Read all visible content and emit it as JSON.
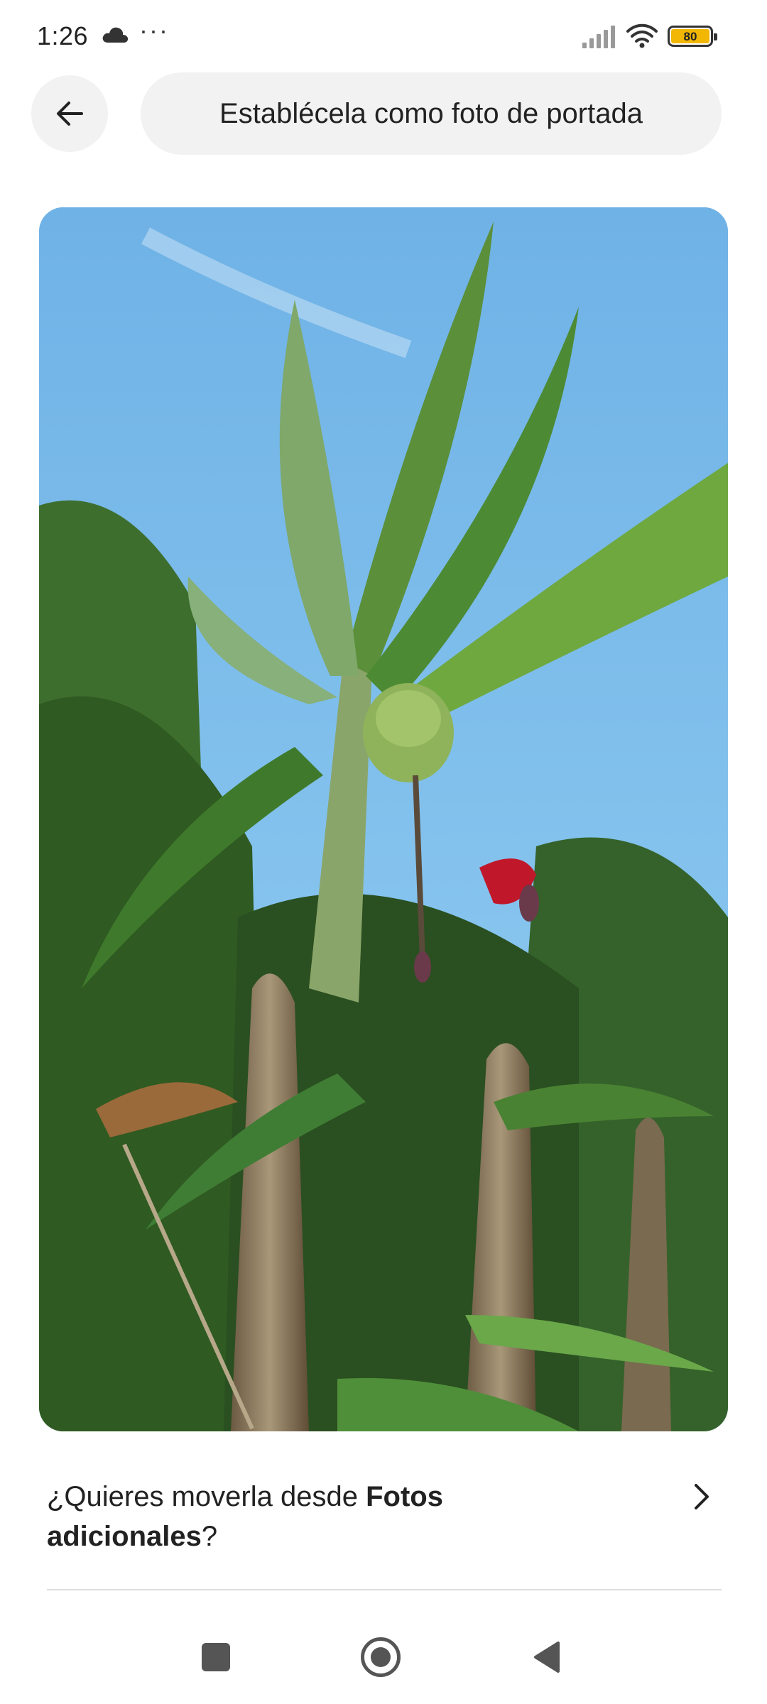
{
  "status_bar": {
    "time": "1:26",
    "more": "···",
    "battery": "80",
    "battery_color": "#f2b705",
    "icons": [
      "cloud-icon",
      "signal-icon",
      "wifi-icon",
      "battery-icon"
    ]
  },
  "header": {
    "back_icon": "arrow-left-icon",
    "cover_button_label": "Establécela como foto de portada"
  },
  "photo": {
    "subject": "banana-plants-photo"
  },
  "move_prompt": {
    "text_prefix": "¿Quieres moverla desde ",
    "text_bold": "Fotos adicionales",
    "text_suffix": "?",
    "icon": "chevron-right-icon"
  },
  "nav_bar": {
    "icons": [
      "recents-square-icon",
      "home-circle-icon",
      "back-triangle-icon"
    ]
  }
}
